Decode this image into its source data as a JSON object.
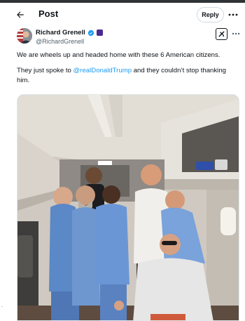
{
  "header": {
    "title": "Post",
    "reply_label": "Reply"
  },
  "author": {
    "display_name": "Richard Grenell",
    "handle": "@RichardGrenell"
  },
  "tweet": {
    "line1": "We are wheels up and headed home with these 6 American citizens.",
    "line2_before": "They just spoke to ",
    "mention": "@realDonaldTrump",
    "line2_after": " and they couldn’t stop thanking him."
  },
  "icons": {
    "back": "arrow-left-icon",
    "more": "more-horizontal-icon",
    "verified": "verified-badge-icon",
    "affiliate": "affiliate-badge-icon",
    "grok": "grok-icon"
  },
  "colors": {
    "accent": "#1d9bf0",
    "text": "#0f1419",
    "secondary": "#536471"
  }
}
